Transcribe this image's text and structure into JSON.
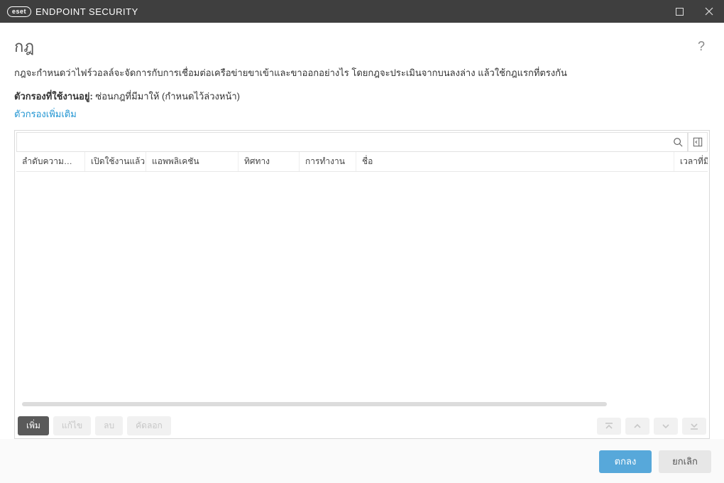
{
  "titlebar": {
    "brand_badge": "eset",
    "product_name": "ENDPOINT SECURITY"
  },
  "page": {
    "title": "กฎ",
    "description": "กฎจะกำหนดว่าไฟร์วอลล์จะจัดการกับการเชื่อมต่อเครือข่ายขาเข้าและขาออกอย่างไร โดยกฎจะประเมินจากบนลงล่าง แล้วใช้กฎแรกที่ตรงกัน",
    "active_filter_label": "ตัวกรองที่ใช้งานอยู่:",
    "active_filter_value": "ซ่อนกฎที่มีมาให้ (กำหนดไว้ล่วงหน้า)",
    "more_filters_link": "ตัวกรองเพิ่มเติม"
  },
  "search": {
    "placeholder": ""
  },
  "columns": {
    "c0": "ลำดับความ…",
    "c1": "เปิดใช้งานแล้ว",
    "c2": "แอพพลิเคชัน",
    "c3": "ทิศทาง",
    "c4": "การทำงาน",
    "c5": "ชื่อ",
    "c6": "เวลาที่มี"
  },
  "actions": {
    "add": "เพิ่ม",
    "edit": "แก้ไข",
    "delete": "ลบ",
    "copy": "คัดลอก"
  },
  "footer": {
    "ok": "ตกลง",
    "cancel": "ยกเลิก"
  }
}
